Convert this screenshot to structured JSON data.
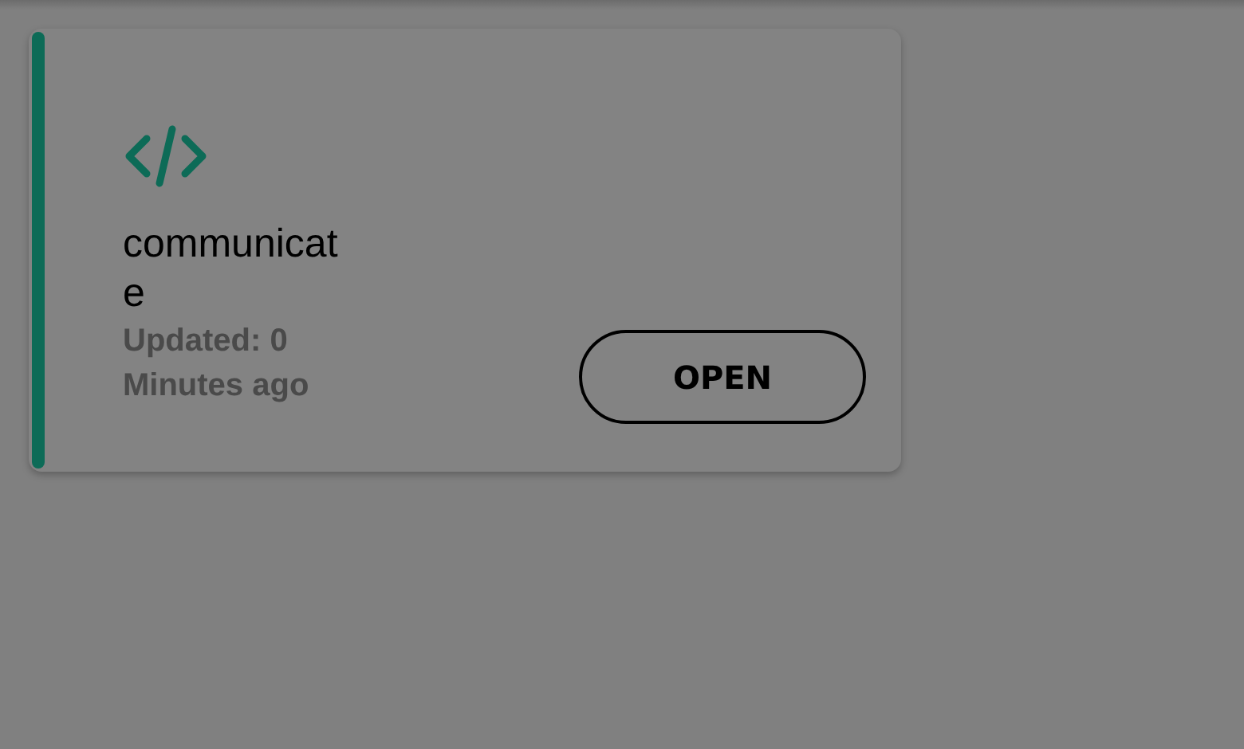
{
  "card": {
    "title": "communicate",
    "updated": "Updated: 0 Minutes ago",
    "button": "OPEN"
  }
}
